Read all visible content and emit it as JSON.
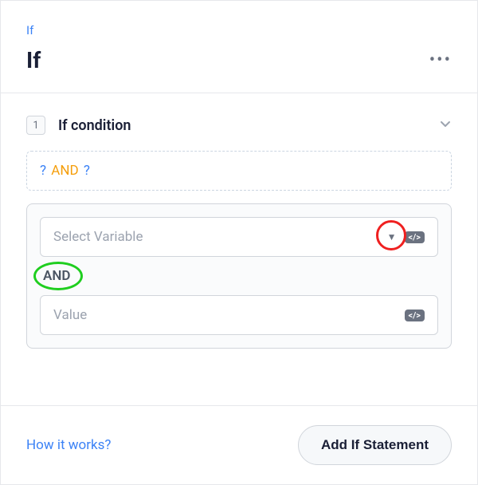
{
  "header": {
    "breadcrumb": "If",
    "title": "If"
  },
  "condition": {
    "index": "1",
    "label": "If condition",
    "expression": {
      "left_qmark": "?",
      "operator": "AND",
      "right_qmark": "?"
    }
  },
  "inputs": {
    "variable_placeholder": "Select Variable",
    "operator_label": "AND",
    "value_placeholder": "Value",
    "code_badge": "</>"
  },
  "footer": {
    "how_link": "How it works?",
    "add_button": "Add If Statement"
  }
}
